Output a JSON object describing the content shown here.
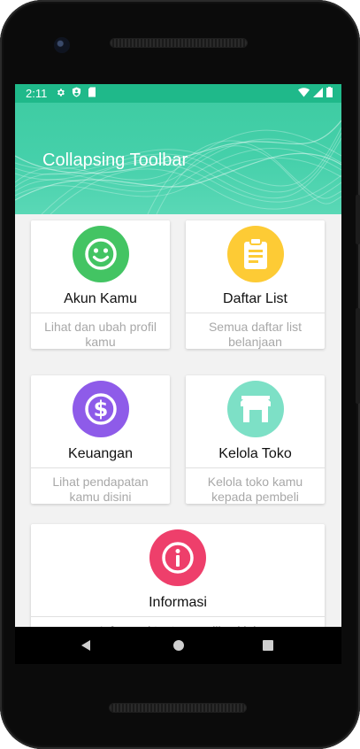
{
  "status_bar": {
    "time": "2:11",
    "left_icons": [
      "gear-icon",
      "shield-icon",
      "sim-icon"
    ],
    "right_icons": [
      "wifi-icon",
      "signal-icon",
      "battery-icon"
    ],
    "color": "#1fb98a"
  },
  "toolbar": {
    "title": "Collapsing Toolbar",
    "color": "#45d0aa"
  },
  "cards": [
    {
      "title": "Akun Kamu",
      "description": "Lihat dan ubah profil kamu",
      "icon": "smiley-icon",
      "color": "#43c463"
    },
    {
      "title": "Daftar List",
      "description": "Semua daftar list belanjaan",
      "icon": "clipboard-icon",
      "color": "#fdcb35"
    },
    {
      "title": "Keuangan",
      "description": "Lihat pendapatan kamu disini",
      "icon": "dollar-icon",
      "color": "#8e5be9"
    },
    {
      "title": "Kelola Toko",
      "description": "Kelola toko kamu kepada pembeli",
      "icon": "store-icon",
      "color": "#7de0c6"
    },
    {
      "title": "Informasi",
      "description": "Informasi tentang aplikasi ini",
      "icon": "info-icon",
      "color": "#ee3f6b"
    }
  ],
  "nav_bar": {
    "buttons": [
      "back-icon",
      "home-icon",
      "recents-icon"
    ]
  }
}
